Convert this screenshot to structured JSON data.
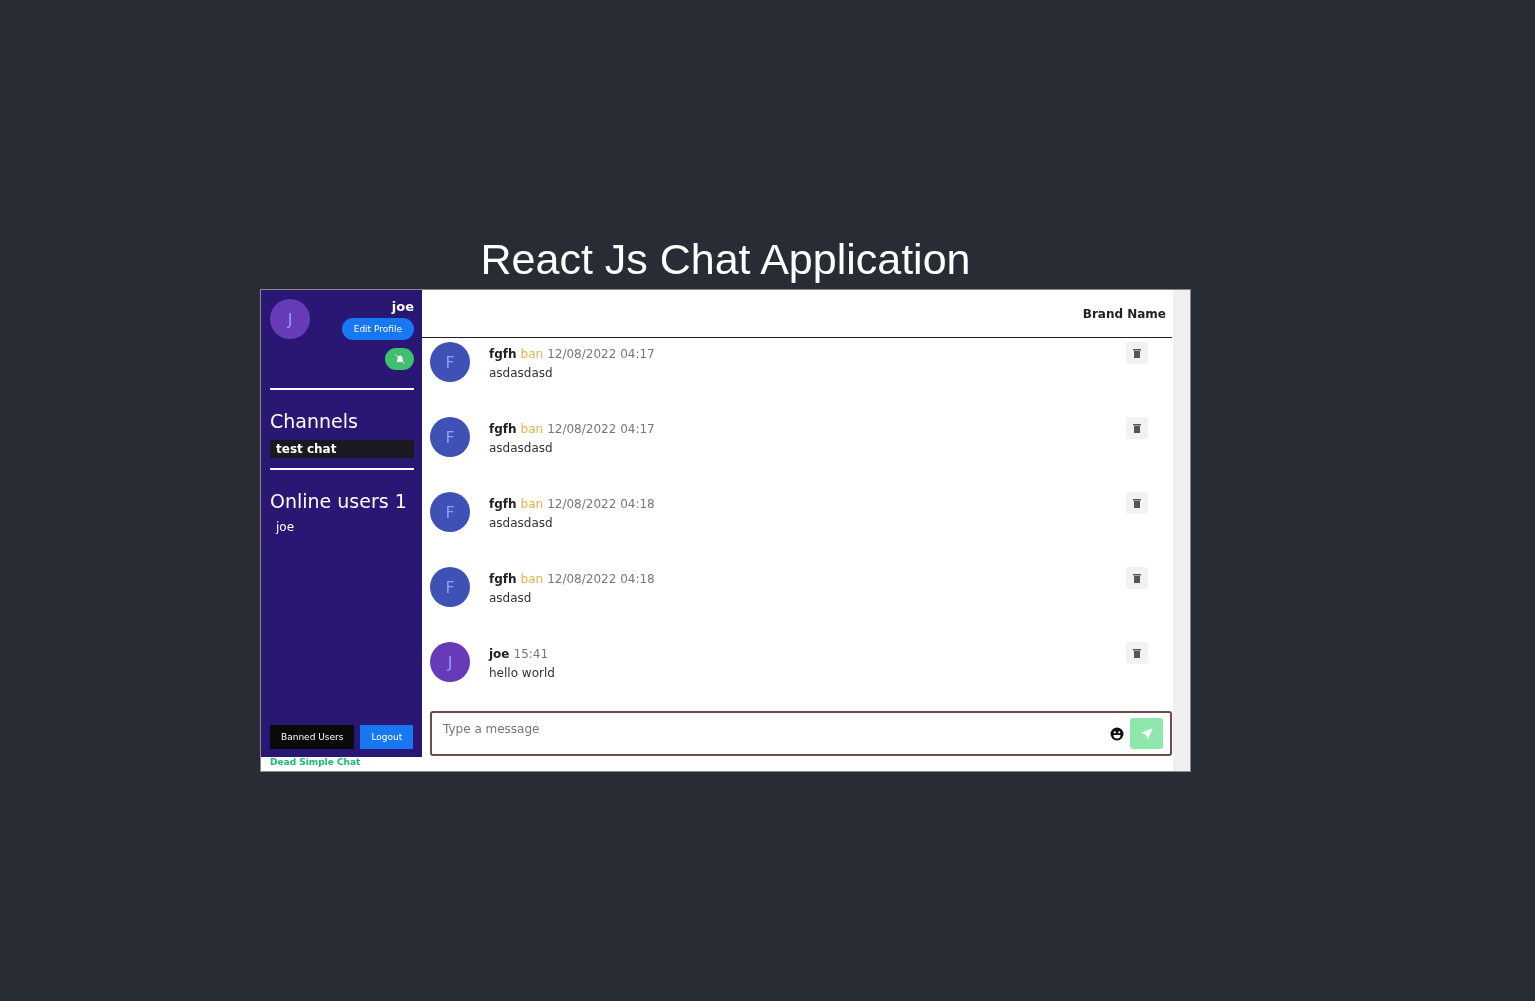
{
  "page_title": "React Js Chat Application",
  "sidebar": {
    "user": {
      "name": "joe",
      "initial": "J"
    },
    "edit_profile": "Edit Profile",
    "notifications_muted": true,
    "channels_heading": "Channels",
    "channels": [
      {
        "name": "test chat",
        "selected": true
      }
    ],
    "online_heading": "Online users 1",
    "online_users": [
      "joe"
    ],
    "banned_users_button": "Banned Users",
    "logout_button": "Logout"
  },
  "footer_brand": "Dead Simple Chat",
  "chat": {
    "brand": "Brand Name",
    "messages": [
      {
        "initial": "F",
        "color": "#3f51b5",
        "author": "fgfh",
        "ban": "ban",
        "time": "12/08/2022 04:17",
        "text": "asdasdasd"
      },
      {
        "initial": "F",
        "color": "#3f51b5",
        "author": "fgfh",
        "ban": "ban",
        "time": "12/08/2022 04:17",
        "text": "asdasdasd"
      },
      {
        "initial": "F",
        "color": "#3f51b5",
        "author": "fgfh",
        "ban": "ban",
        "time": "12/08/2022 04:18",
        "text": "asdasdasd"
      },
      {
        "initial": "F",
        "color": "#3f51b5",
        "author": "fgfh",
        "ban": "ban",
        "time": "12/08/2022 04:18",
        "text": "asdasd"
      },
      {
        "initial": "J",
        "color": "#673ab7",
        "author": "joe",
        "time": "15:41",
        "text": "hello world"
      }
    ],
    "composer": {
      "placeholder": "Type a message"
    }
  }
}
